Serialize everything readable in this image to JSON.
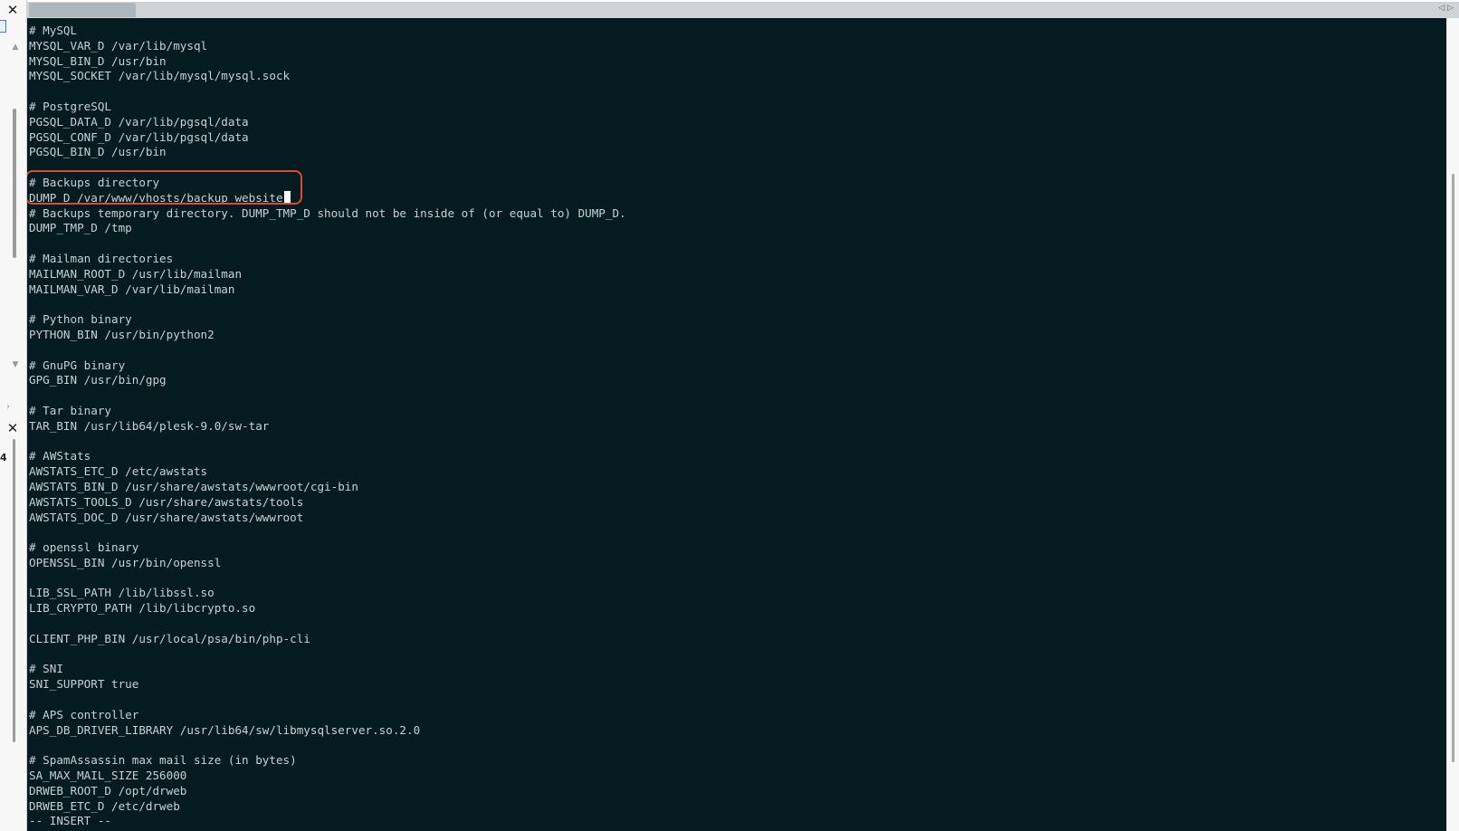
{
  "left_pane": {
    "close_glyph": "✕",
    "up_arrow": "▲",
    "down_arrow": "▼",
    "chevron": "›",
    "side_number": "4"
  },
  "terminal": {
    "tab_label": "",
    "tab_arrows": "◁ ▷",
    "cursor_line_index": 11,
    "lines": [
      "# MySQL",
      "MYSQL_VAR_D /var/lib/mysql",
      "MYSQL_BIN_D /usr/bin",
      "MYSQL_SOCKET /var/lib/mysql/mysql.sock",
      "",
      "# PostgreSQL",
      "PGSQL_DATA_D /var/lib/pgsql/data",
      "PGSQL_CONF_D /var/lib/pgsql/data",
      "PGSQL_BIN_D /usr/bin",
      "",
      "# Backups directory",
      "DUMP_D /var/www/vhosts/backup_website",
      "# Backups temporary directory. DUMP_TMP_D should not be inside of (or equal to) DUMP_D.",
      "DUMP_TMP_D /tmp",
      "",
      "# Mailman directories",
      "MAILMAN_ROOT_D /usr/lib/mailman",
      "MAILMAN_VAR_D /var/lib/mailman",
      "",
      "# Python binary",
      "PYTHON_BIN /usr/bin/python2",
      "",
      "# GnuPG binary",
      "GPG_BIN /usr/bin/gpg",
      "",
      "# Tar binary",
      "TAR_BIN /usr/lib64/plesk-9.0/sw-tar",
      "",
      "# AWStats",
      "AWSTATS_ETC_D /etc/awstats",
      "AWSTATS_BIN_D /usr/share/awstats/wwwroot/cgi-bin",
      "AWSTATS_TOOLS_D /usr/share/awstats/tools",
      "AWSTATS_DOC_D /usr/share/awstats/wwwroot",
      "",
      "# openssl binary",
      "OPENSSL_BIN /usr/bin/openssl",
      "",
      "LIB_SSL_PATH /lib/libssl.so",
      "LIB_CRYPTO_PATH /lib/libcrypto.so",
      "",
      "CLIENT_PHP_BIN /usr/local/psa/bin/php-cli",
      "",
      "# SNI",
      "SNI_SUPPORT true",
      "",
      "# APS controller",
      "APS_DB_DRIVER_LIBRARY /usr/lib64/sw/libmysqlserver.so.2.0",
      "",
      "# SpamAssassin max mail size (in bytes)",
      "SA_MAX_MAIL_SIZE 256000",
      "DRWEB_ROOT_D /opt/drweb",
      "DRWEB_ETC_D /etc/drweb",
      "-- INSERT --"
    ]
  },
  "colors": {
    "terminal_bg": "#041b20",
    "terminal_fg": "#c7d2d6",
    "highlight": "#e0483a"
  }
}
